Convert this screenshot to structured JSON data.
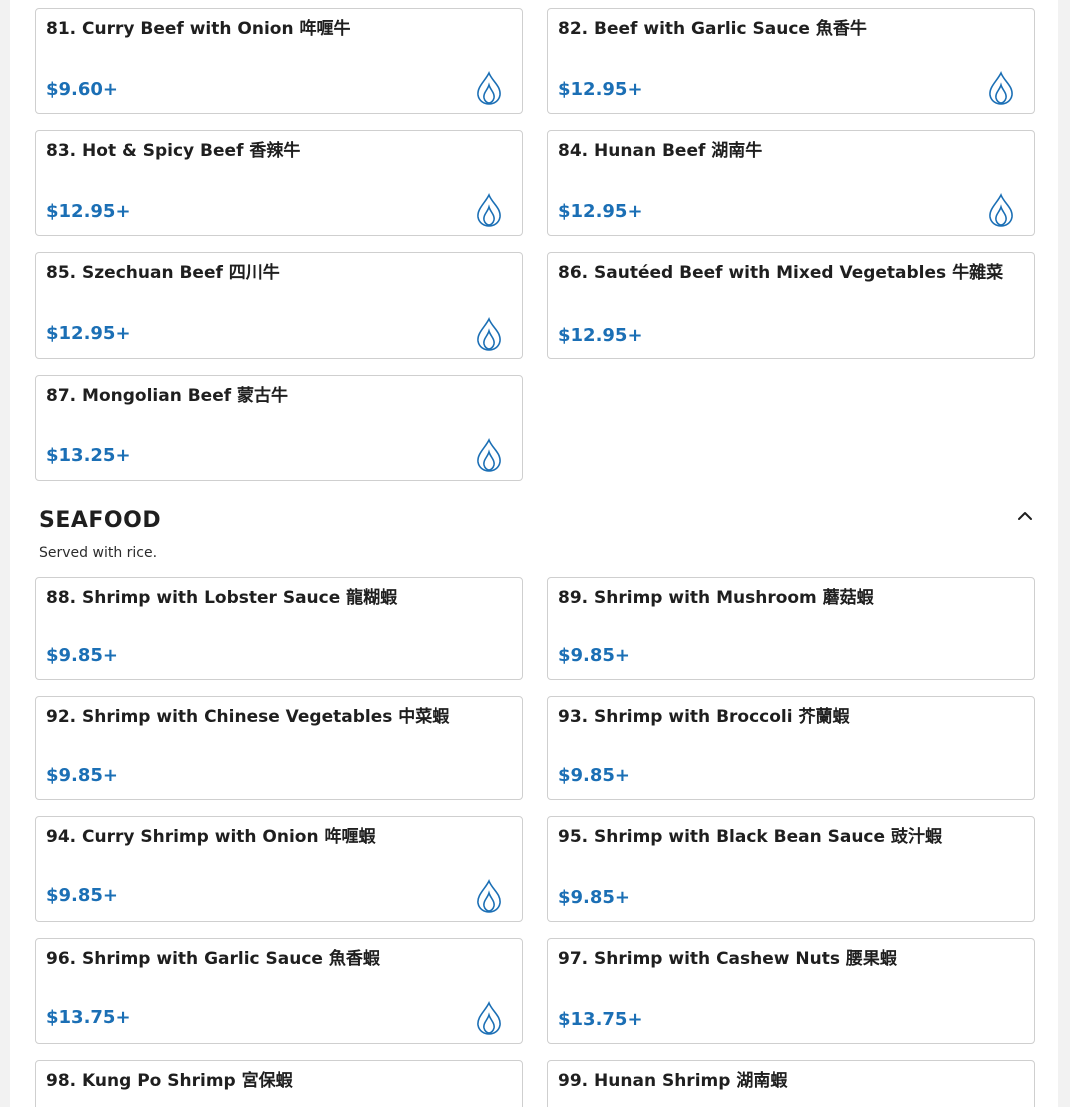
{
  "beef_items": [
    {
      "title": "81. Curry Beef with Onion 哖喱牛",
      "price": "$9.60+",
      "spicy": true
    },
    {
      "title": "82. Beef with Garlic Sauce 魚香牛",
      "price": "$12.95+",
      "spicy": true
    },
    {
      "title": "83. Hot & Spicy Beef 香辣牛",
      "price": "$12.95+",
      "spicy": true
    },
    {
      "title": "84. Hunan Beef 湖南牛",
      "price": "$12.95+",
      "spicy": true
    },
    {
      "title": "85. Szechuan Beef 四川牛",
      "price": "$12.95+",
      "spicy": true
    },
    {
      "title": "86. Sautéed Beef with Mixed Vegetables 牛雜菜",
      "price": "$12.95+",
      "spicy": false
    },
    {
      "title": "87. Mongolian Beef 蒙古牛",
      "price": "$13.25+",
      "spicy": true
    }
  ],
  "seafood": {
    "heading": "SEAFOOD",
    "description": "Served with rice.",
    "items": [
      {
        "title": "88. Shrimp with Lobster Sauce 龍糊蝦",
        "price": "$9.85+",
        "spicy": false
      },
      {
        "title": "89. Shrimp with Mushroom 蘑菇蝦",
        "price": "$9.85+",
        "spicy": false
      },
      {
        "title": "92. Shrimp with Chinese Vegetables 中菜蝦",
        "price": "$9.85+",
        "spicy": false
      },
      {
        "title": "93. Shrimp with Broccoli 芥蘭蝦",
        "price": "$9.85+",
        "spicy": false
      },
      {
        "title": "94. Curry Shrimp with Onion 哖喱蝦",
        "price": "$9.85+",
        "spicy": true
      },
      {
        "title": "95. Shrimp with Black Bean Sauce 豉汁蝦",
        "price": "$9.85+",
        "spicy": false
      },
      {
        "title": "96. Shrimp with Garlic Sauce 魚香蝦",
        "price": "$13.75+",
        "spicy": true
      },
      {
        "title": "97. Shrimp with Cashew Nuts 腰果蝦",
        "price": "$13.75+",
        "spicy": false
      },
      {
        "title": "98. Kung Po Shrimp 宮保蝦",
        "price": "",
        "spicy": false
      },
      {
        "title": "99. Hunan Shrimp 湖南蝦",
        "price": "",
        "spicy": false
      }
    ]
  },
  "colors": {
    "price": "#1b6fb5",
    "spicy_icon": "#1b6fb5",
    "card_border": "#cfcfcf"
  },
  "icons": {
    "spicy": "flame-icon",
    "collapse": "chevron-up-icon"
  }
}
